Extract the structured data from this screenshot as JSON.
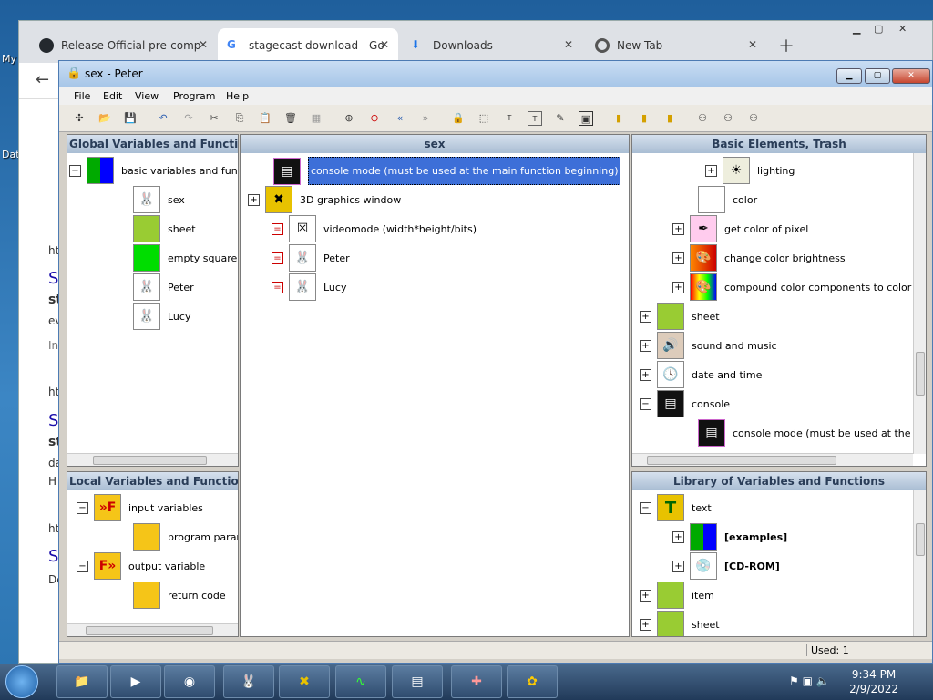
{
  "desktop": {
    "label1": "My",
    "label2": "Dat"
  },
  "browser": {
    "tabs": [
      {
        "label": "Release Official pre-comp"
      },
      {
        "label": "stagecast download - Go"
      },
      {
        "label": "Downloads"
      },
      {
        "label": "New Tab"
      }
    ],
    "bg_lines": [
      "ht",
      "S",
      "st",
      "ev",
      "In",
      "ht",
      "S",
      "st",
      "da",
      "H",
      "ht",
      "S",
      "De"
    ]
  },
  "app": {
    "title": "sex - Peter",
    "menu": [
      "File",
      "Edit",
      "View",
      "Program",
      "Help"
    ],
    "global_panel": {
      "header": "Global Variables and Functio",
      "items": [
        {
          "label": "basic variables and funct",
          "depth": 0,
          "pm": "−"
        },
        {
          "label": "sex",
          "depth": 1,
          "pm": ""
        },
        {
          "label": "sheet",
          "depth": 1,
          "pm": ""
        },
        {
          "label": "empty square",
          "depth": 1,
          "pm": ""
        },
        {
          "label": "Peter",
          "depth": 1,
          "pm": ""
        },
        {
          "label": "Lucy",
          "depth": 1,
          "pm": ""
        }
      ]
    },
    "local_panel": {
      "header": "Local Variables and Function",
      "items": [
        {
          "label": "input variables",
          "depth": 0,
          "pm": "−"
        },
        {
          "label": "program parame",
          "depth": 1,
          "pm": ""
        },
        {
          "label": "output variable",
          "depth": 0,
          "pm": "−"
        },
        {
          "label": "return code",
          "depth": 1,
          "pm": ""
        }
      ]
    },
    "center_panel": {
      "header": "sex",
      "items": [
        {
          "label": "console mode (must be used at the main function beginning)",
          "pm": "",
          "selected": true
        },
        {
          "label": "3D graphics window",
          "pm": "+"
        },
        {
          "label": "videomode (width*height/bits)",
          "pm": "="
        },
        {
          "label": "Peter",
          "pm": "="
        },
        {
          "label": "Lucy",
          "pm": "="
        }
      ]
    },
    "basic_panel": {
      "header": "Basic Elements, Trash",
      "items": [
        {
          "label": "lighting",
          "depth": 1,
          "pm": "+"
        },
        {
          "label": "color",
          "depth": 1,
          "pm": ""
        },
        {
          "label": "get color of pixel",
          "depth": 1,
          "pm": "+"
        },
        {
          "label": "change color brightness",
          "depth": 1,
          "pm": "+"
        },
        {
          "label": "compound color components to color",
          "depth": 1,
          "pm": "+"
        },
        {
          "label": "sheet",
          "depth": 0,
          "pm": "+"
        },
        {
          "label": "sound and music",
          "depth": 0,
          "pm": "+"
        },
        {
          "label": "date and time",
          "depth": 0,
          "pm": "+"
        },
        {
          "label": "console",
          "depth": 0,
          "pm": "−"
        },
        {
          "label": "console mode (must be used at the main",
          "depth": 1,
          "pm": ""
        }
      ]
    },
    "library_panel": {
      "header": "Library of Variables and Functions",
      "items": [
        {
          "label": "text",
          "depth": 0,
          "pm": "−",
          "bold": false
        },
        {
          "label": "[examples]",
          "depth": 1,
          "pm": "+",
          "bold": true
        },
        {
          "label": "[CD-ROM]",
          "depth": 1,
          "pm": "+",
          "bold": true
        },
        {
          "label": "item",
          "depth": 0,
          "pm": "+",
          "bold": false
        },
        {
          "label": "sheet",
          "depth": 0,
          "pm": "+",
          "bold": false
        }
      ]
    },
    "status": "Used: 1"
  },
  "taskbar": {
    "time": "9:34 PM",
    "date": "2/9/2022"
  }
}
